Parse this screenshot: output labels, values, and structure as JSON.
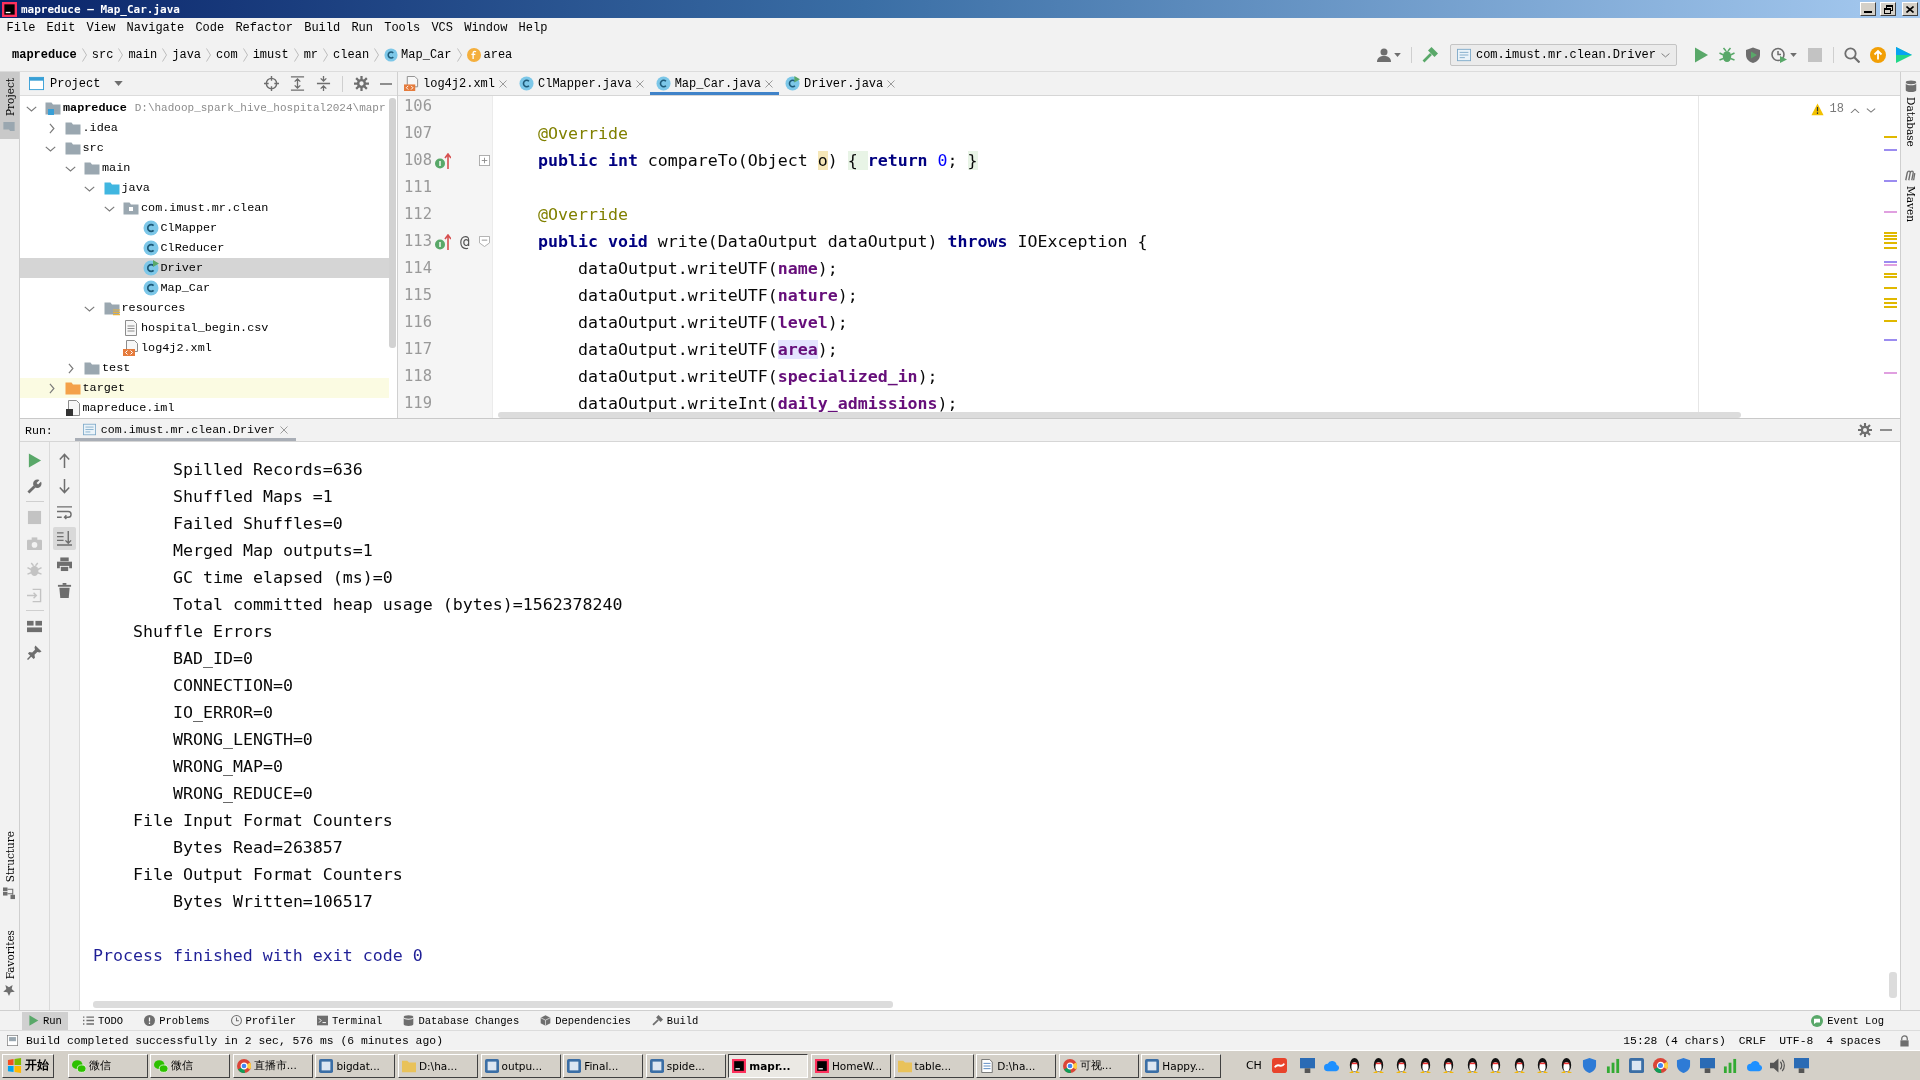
{
  "window": {
    "title": "mapreduce – Map_Car.java"
  },
  "menu": [
    "File",
    "Edit",
    "View",
    "Navigate",
    "Code",
    "Refactor",
    "Build",
    "Run",
    "Tools",
    "VCS",
    "Window",
    "Help"
  ],
  "breadcrumbs": [
    {
      "label": "mapreduce",
      "kind": "project"
    },
    {
      "label": "src",
      "kind": "dir"
    },
    {
      "label": "main",
      "kind": "dir"
    },
    {
      "label": "java",
      "kind": "dir"
    },
    {
      "label": "com",
      "kind": "dir"
    },
    {
      "label": "imust",
      "kind": "dir"
    },
    {
      "label": "mr",
      "kind": "dir"
    },
    {
      "label": "clean",
      "kind": "dir"
    },
    {
      "label": "Map_Car",
      "kind": "class"
    },
    {
      "label": "area",
      "kind": "field"
    }
  ],
  "toolbar": {
    "run_configuration": "com.imust.mr.clean.Driver",
    "actions": [
      {
        "kind": "run",
        "disabled": false
      },
      {
        "kind": "debug",
        "disabled": false
      },
      {
        "kind": "coverage",
        "disabled": false
      },
      {
        "kind": "profile",
        "disabled": false
      },
      {
        "kind": "stop",
        "disabled": true
      }
    ]
  },
  "left_stripe": {
    "top": [
      {
        "label": "Project",
        "kind": "project",
        "selected": true
      }
    ],
    "bottom": [
      {
        "label": "Structure",
        "kind": "structure",
        "selected": false
      },
      {
        "label": "Favorites",
        "kind": "favorites",
        "selected": false
      }
    ]
  },
  "right_stripe": [
    {
      "label": "Database",
      "kind": "database",
      "selected": false
    },
    {
      "label": "Maven",
      "kind": "maven",
      "selected": false
    }
  ],
  "project_panel": {
    "title": "Project",
    "tree": [
      {
        "label": "mapreduce",
        "kind": "module",
        "path": "D:\\hadoop_spark_hive_hospital2024\\mapr",
        "expanded": true,
        "selected": false,
        "children": [
          {
            "label": ".idea",
            "kind": "folder",
            "expanded": false,
            "selected": false
          },
          {
            "label": "src",
            "kind": "folder",
            "expanded": true,
            "selected": false,
            "children": [
              {
                "label": "main",
                "kind": "folder",
                "expanded": true,
                "selected": false,
                "children": [
                  {
                    "label": "java",
                    "kind": "source_folder",
                    "expanded": true,
                    "selected": false,
                    "children": [
                      {
                        "label": "com.imust.mr.clean",
                        "kind": "package",
                        "expanded": true,
                        "selected": false,
                        "children": [
                          {
                            "label": "ClMapper",
                            "kind": "class",
                            "selected": false
                          },
                          {
                            "label": "ClReducer",
                            "kind": "class",
                            "selected": false
                          },
                          {
                            "label": "Driver",
                            "kind": "runnable_class",
                            "selected": true
                          },
                          {
                            "label": "Map_Car",
                            "kind": "class",
                            "selected": false
                          }
                        ]
                      }
                    ]
                  },
                  {
                    "label": "resources",
                    "kind": "resources_folder",
                    "expanded": true,
                    "selected": false,
                    "children": [
                      {
                        "label": "hospital_begin.csv",
                        "kind": "file",
                        "selected": false
                      },
                      {
                        "label": "log4j2.xml",
                        "kind": "xml",
                        "selected": false
                      }
                    ]
                  }
                ]
              },
              {
                "label": "test",
                "kind": "folder",
                "expanded": false,
                "selected": false
              }
            ]
          },
          {
            "label": "target",
            "kind": "excluded_folder",
            "expanded": false,
            "selected": false
          },
          {
            "label": "mapreduce.iml",
            "kind": "iml",
            "selected": false
          }
        ]
      }
    ]
  },
  "editor": {
    "tabs": [
      {
        "label": "log4j2.xml",
        "kind": "xml",
        "selected": false
      },
      {
        "label": "ClMapper.java",
        "kind": "class",
        "selected": false
      },
      {
        "label": "Map_Car.java",
        "kind": "class",
        "selected": true
      },
      {
        "label": "Driver.java",
        "kind": "runnable_class",
        "selected": false
      }
    ],
    "warning_count": "18",
    "lines": [
      {
        "number": "106"
      },
      {
        "number": "107",
        "tokens": [
          {
            "text": "    @Override",
            "kind": "annotation"
          }
        ]
      },
      {
        "number": "108",
        "markers": [
          {
            "kind": "implements"
          }
        ],
        "folded": true,
        "tokens": [
          {
            "text": "    public int",
            "kind": "keyword"
          },
          {
            "text": " compareTo(Object ",
            "kind": "plain"
          },
          {
            "text": "o",
            "kind": "param_highlight"
          },
          {
            "text": ") ",
            "kind": "plain"
          },
          {
            "text": "{ ",
            "kind": "fold"
          },
          {
            "text": "return ",
            "kind": "keyword"
          },
          {
            "text": "0",
            "kind": "number"
          },
          {
            "text": "; ",
            "kind": "plain"
          },
          {
            "text": "}",
            "kind": "fold"
          }
        ]
      },
      {
        "number": "111"
      },
      {
        "number": "112",
        "tokens": [
          {
            "text": "    @Override",
            "kind": "annotation"
          }
        ]
      },
      {
        "number": "113",
        "markers": [
          {
            "kind": "implements"
          },
          {
            "kind": "symbol",
            "text": "@"
          }
        ],
        "folded": false,
        "tokens": [
          {
            "text": "    public void",
            "kind": "keyword"
          },
          {
            "text": " write(DataOutput dataOutput) ",
            "kind": "plain"
          },
          {
            "text": "throws",
            "kind": "keyword"
          },
          {
            "text": " IOException {",
            "kind": "plain"
          }
        ]
      },
      {
        "number": "114",
        "tokens": [
          {
            "text": "        dataOutput.writeUTF(",
            "kind": "plain"
          },
          {
            "text": "name",
            "kind": "field"
          },
          {
            "text": ");",
            "kind": "plain"
          }
        ]
      },
      {
        "number": "115",
        "tokens": [
          {
            "text": "        dataOutput.writeUTF(",
            "kind": "plain"
          },
          {
            "text": "nature",
            "kind": "field"
          },
          {
            "text": ");",
            "kind": "plain"
          }
        ]
      },
      {
        "number": "116",
        "tokens": [
          {
            "text": "        dataOutput.writeUTF(",
            "kind": "plain"
          },
          {
            "text": "level",
            "kind": "field"
          },
          {
            "text": ");",
            "kind": "plain"
          }
        ]
      },
      {
        "number": "117",
        "tokens": [
          {
            "text": "        dataOutput.writeUTF(",
            "kind": "plain"
          },
          {
            "text": "area",
            "kind": "field_usage"
          },
          {
            "text": ");",
            "kind": "plain"
          }
        ]
      },
      {
        "number": "118",
        "tokens": [
          {
            "text": "        dataOutput.writeUTF(",
            "kind": "plain"
          },
          {
            "text": "specialized_in",
            "kind": "field"
          },
          {
            "text": ");",
            "kind": "plain"
          }
        ]
      },
      {
        "number": "119",
        "tokens": [
          {
            "text": "        dataOutput.writeInt(",
            "kind": "plain"
          },
          {
            "text": "daily_admissions",
            "kind": "field"
          },
          {
            "text": ");",
            "kind": "plain"
          }
        ]
      }
    ]
  },
  "run_panel": {
    "label": "Run:",
    "tabs": [
      {
        "label": "com.imust.mr.clean.Driver",
        "selected": true
      }
    ],
    "run_toolbar": [
      {
        "kind": "rerun",
        "disabled": false
      },
      {
        "kind": "settings",
        "disabled": false
      },
      {
        "kind": "stop",
        "disabled": true
      },
      {
        "kind": "dump",
        "disabled": true
      },
      {
        "kind": "debug",
        "disabled": true
      },
      {
        "kind": "exit",
        "disabled": true
      },
      {
        "kind": "layout",
        "disabled": false
      },
      {
        "kind": "pin",
        "disabled": false
      }
    ],
    "console_toolbar": [
      {
        "kind": "up",
        "on": false
      },
      {
        "kind": "down",
        "on": false
      },
      {
        "kind": "soft_wrap",
        "on": false
      },
      {
        "kind": "scroll_end",
        "on": true
      },
      {
        "kind": "print",
        "on": false
      },
      {
        "kind": "clear",
        "on": false
      }
    ],
    "output": [
      {
        "kind": "stdout",
        "children": [
          {
            "children": [
              {
                "text": "Spilled Records=636"
              },
              {
                "text": "Shuffled Maps =1"
              },
              {
                "text": "Failed Shuffles=0"
              },
              {
                "text": "Merged Map outputs=1"
              },
              {
                "text": "GC time elapsed (ms)=0"
              },
              {
                "text": "Total committed heap usage (bytes)=1562378240"
              }
            ]
          },
          {
            "text": "Shuffle Errors",
            "children": [
              {
                "text": "BAD_ID=0"
              },
              {
                "text": "CONNECTION=0"
              },
              {
                "text": "IO_ERROR=0"
              },
              {
                "text": "WRONG_LENGTH=0"
              },
              {
                "text": "WRONG_MAP=0"
              },
              {
                "text": "WRONG_REDUCE=0"
              }
            ]
          },
          {
            "text": "File Input Format Counters",
            "children": [
              {
                "text": "Bytes Read=263857"
              }
            ]
          },
          {
            "text": "File Output Format Counters",
            "children": [
              {
                "text": "Bytes Written=106517"
              }
            ]
          }
        ]
      },
      {
        "kind": "system",
        "text": "Process finished with exit code 0"
      }
    ]
  },
  "tool_windows": {
    "left": [
      {
        "label": "Run",
        "kind": "run",
        "selected": true
      },
      {
        "label": "TODO",
        "kind": "todo",
        "selected": false
      },
      {
        "label": "Problems",
        "kind": "problems",
        "selected": false
      },
      {
        "label": "Profiler",
        "kind": "profiler",
        "selected": false
      },
      {
        "label": "Terminal",
        "kind": "terminal",
        "selected": false
      },
      {
        "label": "Database Changes",
        "kind": "database",
        "selected": false
      },
      {
        "label": "Dependencies",
        "kind": "dependencies",
        "selected": false
      },
      {
        "label": "Build",
        "kind": "build",
        "selected": false
      }
    ],
    "right": [
      {
        "label": "Event Log",
        "kind": "event_log"
      }
    ]
  },
  "status_bar": {
    "message": "Build completed successfully in 2 sec, 576 ms (6 minutes ago)",
    "items": [
      "15:28 (4 chars)",
      "CRLF",
      "UTF-8",
      "4 spaces"
    ]
  },
  "taskbar": {
    "start": "开始",
    "buttons": [
      {
        "label": "微信",
        "kind": "chat",
        "selected": false
      },
      {
        "label": "微信",
        "kind": "chat",
        "selected": false
      },
      {
        "label": "直播市...",
        "kind": "browser",
        "selected": false
      },
      {
        "label": "bigdat...",
        "kind": "app",
        "selected": false
      },
      {
        "label": "D:\\ha...",
        "kind": "folder",
        "selected": false
      },
      {
        "label": "outpu...",
        "kind": "app",
        "selected": false
      },
      {
        "label": "Final...",
        "kind": "app",
        "selected": false
      },
      {
        "label": "spide...",
        "kind": "app",
        "selected": false
      },
      {
        "label": "mapr...",
        "kind": "ide",
        "selected": true
      },
      {
        "label": "HomeW...",
        "kind": "ide",
        "selected": false
      },
      {
        "label": "table...",
        "kind": "folder",
        "selected": false
      },
      {
        "label": "D:\\ha...",
        "kind": "document",
        "selected": false
      },
      {
        "label": "可视...",
        "kind": "browser",
        "selected": false
      },
      {
        "label": "Happy...",
        "kind": "app",
        "selected": false
      }
    ],
    "language": "CH"
  }
}
